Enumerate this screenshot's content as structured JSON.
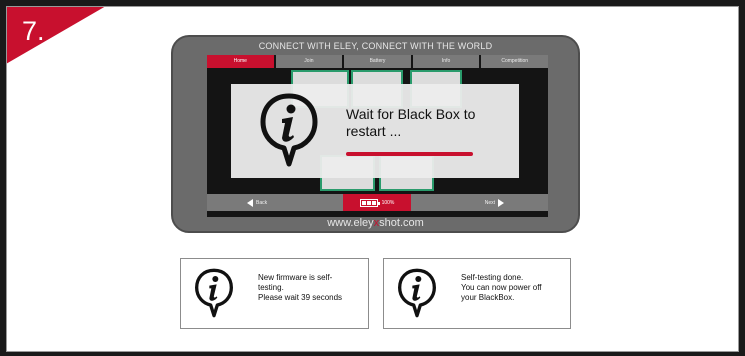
{
  "step": {
    "number": "7."
  },
  "device": {
    "header": "CONNECT WITH ELEY, CONNECT WITH THE WORLD",
    "nav_tabs": [
      {
        "label": "Home",
        "active": true
      },
      {
        "label": "Join",
        "active": false
      },
      {
        "label": "Battery",
        "active": false
      },
      {
        "label": "Info",
        "active": false
      },
      {
        "label": "Competition",
        "active": false
      }
    ],
    "dialog": {
      "icon": "info-bubble-icon",
      "message": "Wait for Black Box to restart ...",
      "progress_indicator": "indeterminate"
    },
    "bottom_bar": {
      "back_label": "Back",
      "next_label": "Next",
      "battery_percent": "100%"
    },
    "url_prefix": "www.eley",
    "url_accent": "x",
    "url_suffix": "shot.com"
  },
  "info_boxes": [
    {
      "icon": "info-bubble-icon",
      "line1": "New firmware is self-",
      "line2": "testing.",
      "line3": "Please wait 39 seconds"
    },
    {
      "icon": "info-bubble-icon",
      "line1": "Self-testing done.",
      "line2": "You can now power off",
      "line3": "your BlackBox."
    }
  ],
  "colors": {
    "accent": "#c8102e",
    "device_body": "#6b6b6b",
    "tab_inactive": "#7a7a7a",
    "tile_border": "#2fb37c"
  }
}
